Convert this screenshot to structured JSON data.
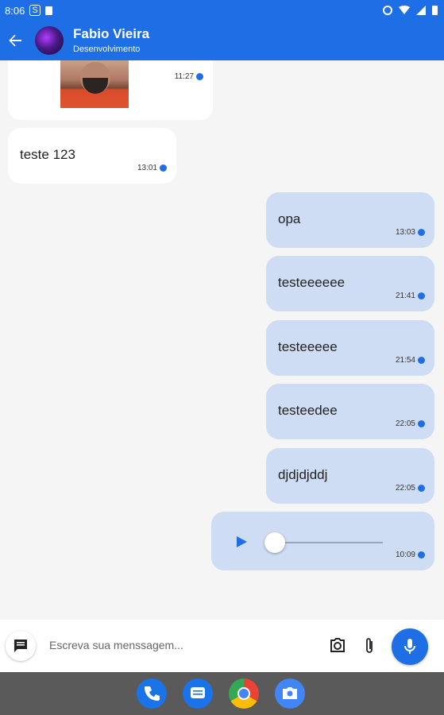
{
  "status_bar": {
    "time": "8:06",
    "s_icon": "S"
  },
  "header": {
    "contact_name": "Fabio Vieira",
    "contact_status": "Desenvolvimento"
  },
  "messages": [
    {
      "direction": "received",
      "kind": "image",
      "time": "11:27"
    },
    {
      "direction": "received",
      "kind": "text",
      "text": "teste 123",
      "time": "13:01"
    },
    {
      "direction": "sent",
      "kind": "text",
      "text": "opa",
      "time": "13:03"
    },
    {
      "direction": "sent",
      "kind": "text",
      "text": "testeeeeee",
      "time": "21:41"
    },
    {
      "direction": "sent",
      "kind": "text",
      "text": "testeeeee",
      "time": "21:54"
    },
    {
      "direction": "sent",
      "kind": "text",
      "text": "testeedee",
      "time": "22:05"
    },
    {
      "direction": "sent",
      "kind": "text",
      "text": "djdjdjddj",
      "time": "22:05"
    },
    {
      "direction": "sent",
      "kind": "audio",
      "time": "10:09",
      "progress": 0
    }
  ],
  "composer": {
    "placeholder": "Escreva sua menssagem..."
  },
  "colors": {
    "primary": "#1e6fe6",
    "sent_bubble": "#cfddf4",
    "received_bubble": "#ffffff",
    "background": "#f5f5f5"
  },
  "icons": [
    "back-arrow-icon",
    "chat-icon",
    "camera-icon",
    "paperclip-icon",
    "mic-icon",
    "phone-icon",
    "messages-icon",
    "chrome-icon",
    "camera-app-icon"
  ]
}
